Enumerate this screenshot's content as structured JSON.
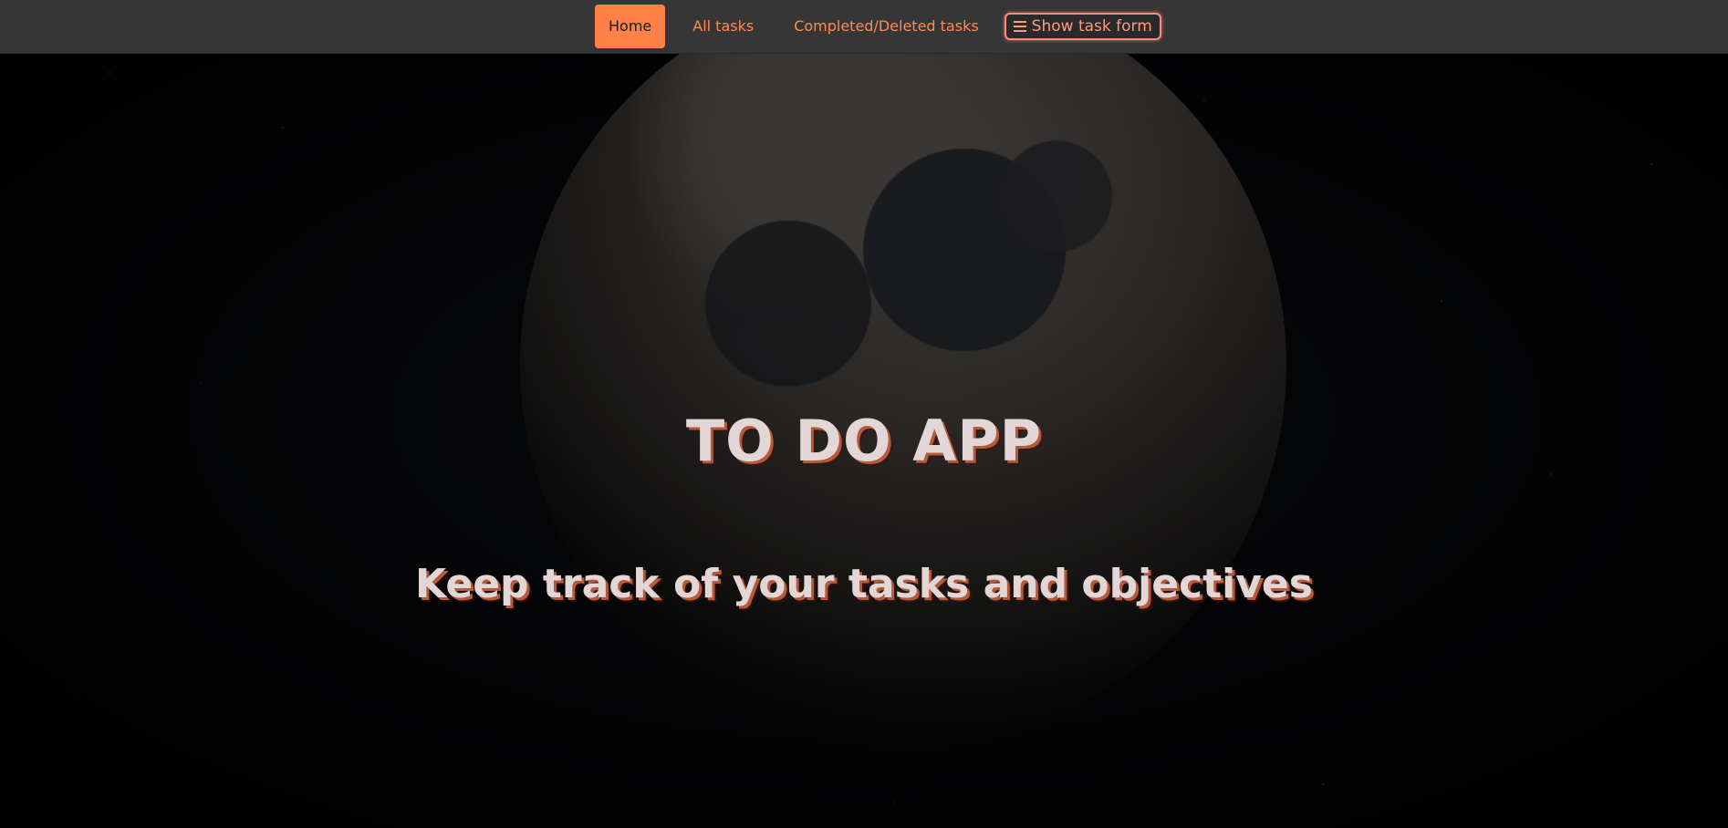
{
  "nav": {
    "items": [
      {
        "label": "Home",
        "active": true
      },
      {
        "label": "All tasks",
        "active": false
      },
      {
        "label": "Completed/Deleted tasks",
        "active": false
      }
    ],
    "toggle_button": {
      "label": "Show task form",
      "icon": "list-icon"
    }
  },
  "hero": {
    "title": "TO DO APP",
    "subtitle": "Keep track of your tasks and objectives"
  },
  "colors": {
    "accent": "#ff8148",
    "navbar": "#363636",
    "text": "#e3d6d6"
  }
}
